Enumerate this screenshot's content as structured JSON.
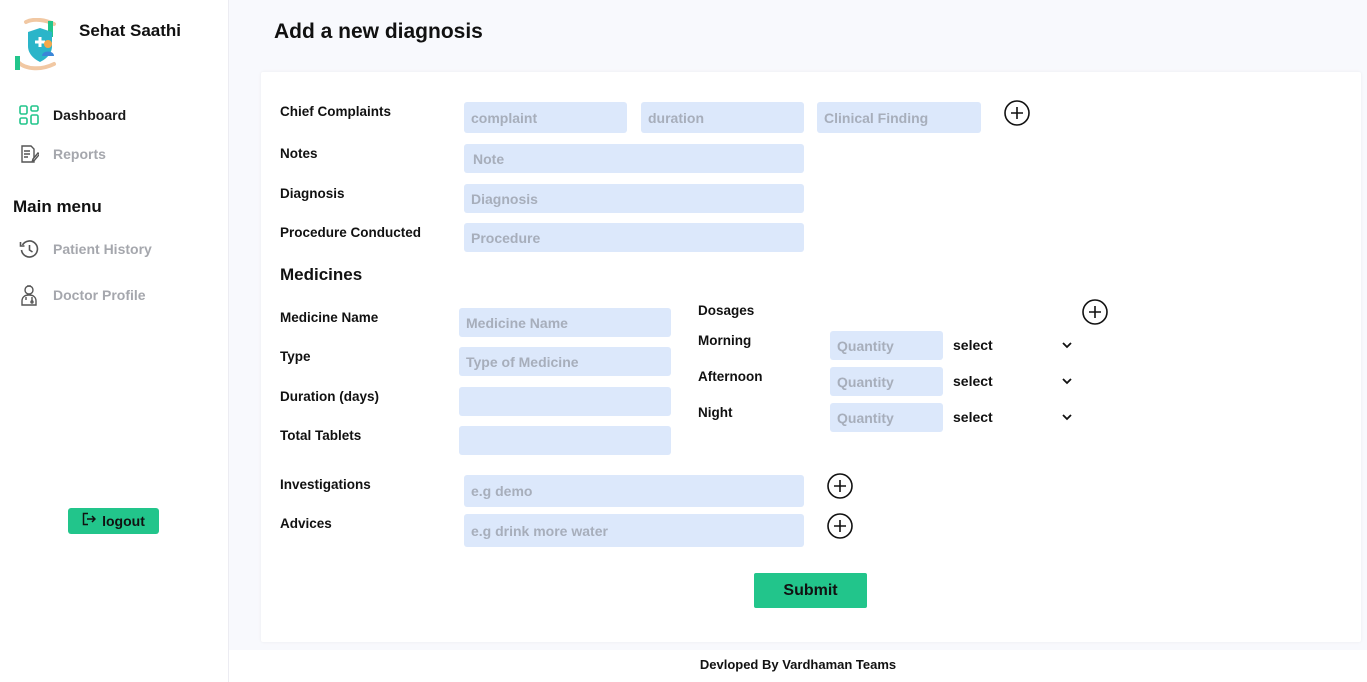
{
  "app": {
    "name": "Sehat Saathi"
  },
  "sidebar": {
    "items": [
      {
        "label": "Dashboard",
        "icon": "dashboard-icon"
      },
      {
        "label": "Reports",
        "icon": "reports-icon"
      }
    ],
    "menu_heading": "Main menu",
    "menu_items": [
      {
        "label": "Patient History",
        "icon": "history-icon"
      },
      {
        "label": "Doctor Profile",
        "icon": "doctor-icon"
      }
    ],
    "logout_label": "logout"
  },
  "page": {
    "title": "Add a new diagnosis"
  },
  "form": {
    "chief_complaints": {
      "label": "Chief Complaints",
      "complaint_placeholder": "complaint",
      "duration_placeholder": "duration",
      "finding_placeholder": "Clinical Finding"
    },
    "notes": {
      "label": "Notes",
      "placeholder": "Note"
    },
    "diagnosis": {
      "label": "Diagnosis",
      "placeholder": "Diagnosis"
    },
    "procedure": {
      "label": "Procedure Conducted",
      "placeholder": "Procedure"
    },
    "medicines": {
      "title": "Medicines",
      "name": {
        "label": "Medicine Name",
        "placeholder": "Medicine Name"
      },
      "type": {
        "label": "Type",
        "placeholder": "Type of Medicine"
      },
      "duration": {
        "label": "Duration (days)",
        "placeholder": ""
      },
      "total": {
        "label": "Total Tablets",
        "placeholder": ""
      },
      "dosages_label": "Dosages",
      "dosages": [
        {
          "label": "Morning",
          "quantity_placeholder": "Quantity",
          "select_value": "select"
        },
        {
          "label": "Afternoon",
          "quantity_placeholder": "Quantity",
          "select_value": "select"
        },
        {
          "label": "Night",
          "quantity_placeholder": "Quantity",
          "select_value": "select"
        }
      ]
    },
    "investigations": {
      "label": "Investigations",
      "placeholder": "e.g demo"
    },
    "advices": {
      "label": "Advices",
      "placeholder": "e.g drink more water"
    },
    "submit_label": "Submit"
  },
  "footer": {
    "text": "Devloped By Vardhaman Teams"
  },
  "colors": {
    "accent": "#22c58b",
    "input_bg": "#dce8fb",
    "muted_text": "#a5a7ad",
    "page_bg": "#f8f9fd"
  }
}
